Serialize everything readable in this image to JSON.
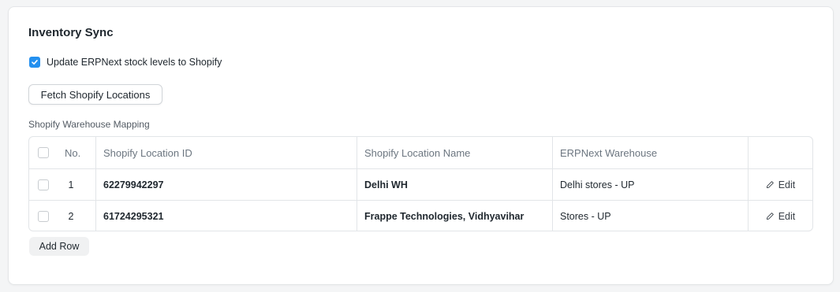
{
  "section": {
    "title": "Inventory Sync"
  },
  "sync_option": {
    "label": "Update ERPNext stock levels to Shopify",
    "checked": true
  },
  "buttons": {
    "fetch_label": "Fetch Shopify Locations",
    "add_row_label": "Add Row"
  },
  "table": {
    "label": "Shopify Warehouse Mapping",
    "columns": [
      "No.",
      "Shopify Location ID",
      "Shopify Location Name",
      "ERPNext Warehouse"
    ],
    "edit_label": "Edit",
    "rows": [
      {
        "no": "1",
        "location_id": "62279942297",
        "location_name": "Delhi WH",
        "warehouse": "Delhi stores - UP"
      },
      {
        "no": "2",
        "location_id": "61724295321",
        "location_name": "Frappe Technologies, Vidhyavihar",
        "warehouse": "Stores - UP"
      }
    ]
  },
  "colors": {
    "accent": "#2490ef",
    "border": "#e2e5e8",
    "muted_text": "#6c7680"
  },
  "icons": {
    "checkbox_checked": "check-icon",
    "edit": "pencil-icon"
  }
}
